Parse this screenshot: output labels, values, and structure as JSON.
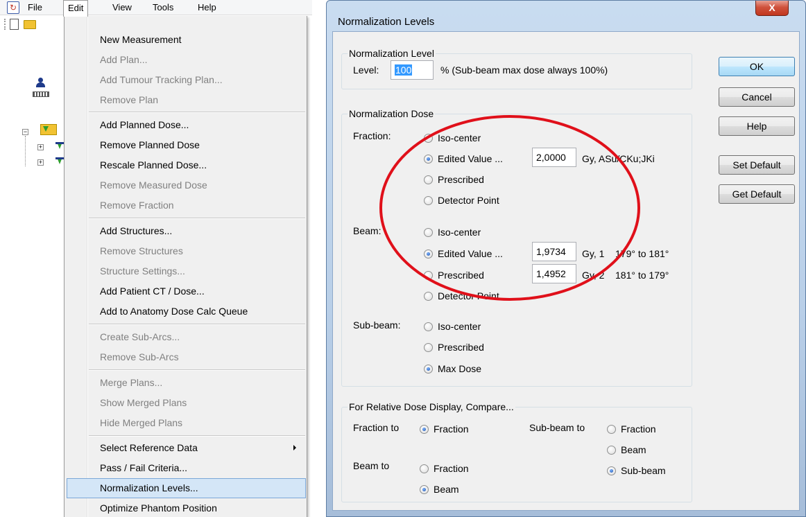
{
  "menubar": {
    "items": [
      "File",
      "Edit",
      "View",
      "Tools",
      "Help"
    ],
    "open_menu": "Edit"
  },
  "edit_menu": {
    "items": [
      {
        "label": "New Measurement",
        "enabled": true
      },
      {
        "label": "Add Plan...",
        "enabled": false
      },
      {
        "label": "Add Tumour Tracking Plan...",
        "enabled": false
      },
      {
        "label": "Remove Plan",
        "enabled": false
      },
      {
        "label": "Add Planned Dose...",
        "enabled": true
      },
      {
        "label": "Remove Planned Dose",
        "enabled": true
      },
      {
        "label": "Rescale Planned Dose...",
        "enabled": true
      },
      {
        "label": "Remove Measured Dose",
        "enabled": false
      },
      {
        "label": "Remove Fraction",
        "enabled": false
      },
      {
        "label": "Add Structures...",
        "enabled": true
      },
      {
        "label": "Remove Structures",
        "enabled": false
      },
      {
        "label": "Structure Settings...",
        "enabled": false
      },
      {
        "label": "Add Patient CT / Dose...",
        "enabled": true
      },
      {
        "label": "Add to Anatomy Dose Calc Queue",
        "enabled": true
      },
      {
        "label": "Create Sub-Arcs...",
        "enabled": false
      },
      {
        "label": "Remove Sub-Arcs",
        "enabled": false
      },
      {
        "label": "Merge Plans...",
        "enabled": false
      },
      {
        "label": "Show Merged Plans",
        "enabled": false
      },
      {
        "label": "Hide Merged Plans",
        "enabled": false
      },
      {
        "label": "Select Reference Data",
        "enabled": true,
        "submenu": true
      },
      {
        "label": "Pass / Fail Criteria...",
        "enabled": true
      },
      {
        "label": "Normalization Levels...",
        "enabled": true,
        "highlighted": true
      },
      {
        "label": "Optimize Phantom Position",
        "enabled": true
      }
    ]
  },
  "dialog": {
    "title": "Normalization Levels",
    "close_label": "X",
    "norm_level": {
      "legend": "Normalization Level",
      "level_label": "Level:",
      "level_value": "100",
      "unit_note": "%  (Sub-beam max dose always 100%)"
    },
    "norm_dose": {
      "legend": "Normalization Dose",
      "fraction_label": "Fraction:",
      "fraction_options": [
        "Iso-center",
        "Edited Value  ...",
        "Prescribed",
        "Detector Point"
      ],
      "fraction_selected": 1,
      "fraction_value": "2,0000",
      "fraction_unit": "Gy, ASu/CKu;JKi",
      "beam_label": "Beam:",
      "beam_options": [
        "Iso-center",
        "Edited Value  ...",
        "Prescribed",
        "Detector Point"
      ],
      "beam_selected": 1,
      "beam_values": [
        {
          "value": "1,9734",
          "unit": "Gy, 1",
          "range": "179° to 181°"
        },
        {
          "value": "1,4952",
          "unit": "Gy, 2",
          "range": "181° to 179°"
        }
      ],
      "subbeam_label": "Sub-beam:",
      "subbeam_options": [
        "Iso-center",
        "Prescribed",
        "Max Dose"
      ],
      "subbeam_selected": 2
    },
    "relative": {
      "legend": "For Relative Dose Display, Compare...",
      "fraction_to_label": "Fraction to",
      "fraction_to_option": "Fraction",
      "beam_to_label": "Beam to",
      "beam_to_options": [
        "Fraction",
        "Beam"
      ],
      "beam_to_selected": 1,
      "subbeam_to_label": "Sub-beam to",
      "subbeam_to_options": [
        "Fraction",
        "Beam",
        "Sub-beam"
      ],
      "subbeam_to_selected": 2
    },
    "buttons": {
      "ok": "OK",
      "cancel": "Cancel",
      "help": "Help",
      "set_default": "Set Default",
      "get_default": "Get Default"
    }
  },
  "colors": {
    "annotation": "#e0101a",
    "menu_highlight": "#d4e6f7",
    "selection": "#3399ff"
  }
}
